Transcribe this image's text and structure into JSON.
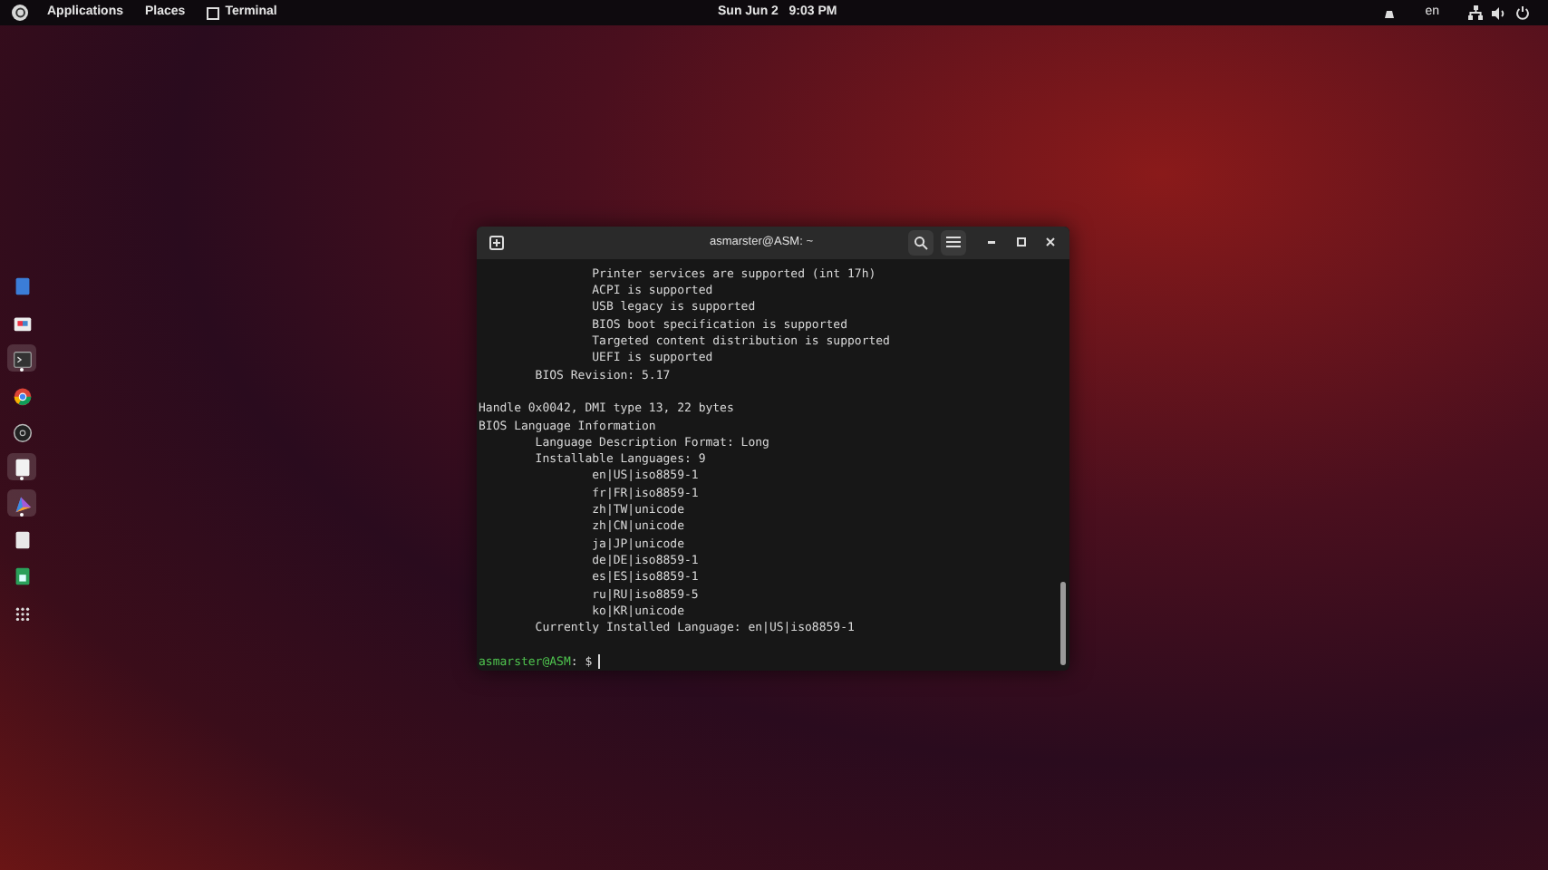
{
  "top_bar": {
    "menus": [
      "Applications",
      "Places",
      "Terminal"
    ],
    "clock": "Sun Jun 2   9:03 PM",
    "language": "en"
  },
  "dock": [
    {
      "kind": "files",
      "running": false
    },
    {
      "kind": "store",
      "running": false
    },
    {
      "kind": "terminal",
      "running": true
    },
    {
      "kind": "browser",
      "running": false
    },
    {
      "kind": "media",
      "running": false
    },
    {
      "kind": "document",
      "running": true
    },
    {
      "kind": "paint",
      "running": true
    },
    {
      "kind": "text",
      "running": false
    },
    {
      "kind": "spreadsheet",
      "running": false
    },
    {
      "kind": "grid",
      "running": false
    }
  ],
  "terminal": {
    "title": "asmarster@ASM: ~",
    "blocks": [
      [
        "                Printer services are supported (int 17h)",
        "                ACPI is supported",
        "                USB legacy is supported",
        "                BIOS boot specification is supported",
        "                Targeted content distribution is supported",
        "                UEFI is supported",
        "        BIOS Revision: 5.17"
      ],
      [
        "Handle 0x0042, DMI type 13, 22 bytes",
        "BIOS Language Information",
        "        Language Description Format: Long",
        "        Installable Languages: 9",
        "                en|US|iso8859-1",
        "                fr|FR|iso8859-1",
        "                zh|TW|unicode",
        "                zh|CN|unicode",
        "                ja|JP|unicode",
        "                de|DE|iso8859-1",
        "                es|ES|iso8859-1",
        "                ru|RU|iso8859-5",
        "                ko|KR|unicode",
        "        Currently Installed Language: en|US|iso8859-1"
      ]
    ],
    "prompt_user": "asmarster@ASM",
    "prompt_rest": ": $"
  }
}
